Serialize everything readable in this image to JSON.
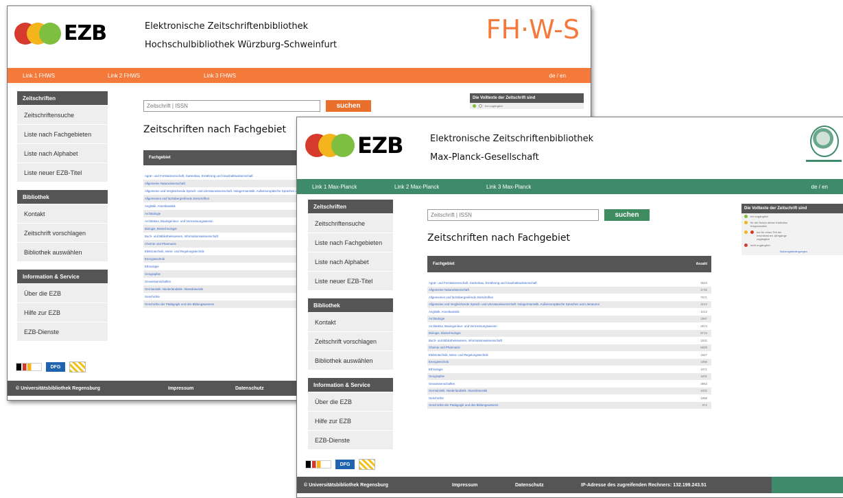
{
  "colors": {
    "fhws_orange": "#f47a3c",
    "mpg_green": "#3e8a6b",
    "button_orange": "#e8702c",
    "button_green": "#3f8c60",
    "dark": "#555555",
    "dot_red": "#d63a2c",
    "dot_yellow": "#f3b41c",
    "dot_green": "#7fbf3f",
    "dot_blue": "#1f78b4"
  },
  "w1": {
    "logo_text": "EZB",
    "title_line1": "Elektronische Zeitschriftenbibliothek",
    "title_line2": "Hochschulbibliothek Würzburg-Schweinfurt",
    "brand": "FH·W-S",
    "nav": [
      "Link 1 FHWS",
      "Link 2 FHWS",
      "Link 3 FHWS"
    ],
    "lang": "de / en",
    "sidebar": [
      {
        "head": "Zeitschriften",
        "items": [
          "Zeitschriftensuche",
          "Liste nach Fachgebieten",
          "Liste nach Alphabet",
          "Liste neuer EZB-Titel"
        ]
      },
      {
        "head": "Bibliothek",
        "items": [
          "Kontakt",
          "Zeitschrift vorschlagen",
          "Bibliothek auswählen"
        ]
      },
      {
        "head": "Information & Service",
        "items": [
          "Über die EZB",
          "Hilfe zur EZB",
          "EZB-Dienste"
        ]
      }
    ],
    "search_placeholder": "Zeitschrift | ISSN",
    "search_button": "suchen",
    "page_title": "Zeitschriften nach Fachgebiet",
    "table_header": "Fachgebiet",
    "rows": [
      "Agrar- und Forstwissenschaft, Gartenbau, Ernährung und Haushaltswissenschaft",
      "Allgemeine Naturwissenschaft",
      "Allgemeine und Vergleichende Sprach- und Literaturwissenschaft. Indogermanistik. Außereuropäische Sprachen und Literaturen",
      "Allgemeines und fachübergreifende Zeitschriften",
      "Anglistik. Amerikanistik",
      "Archäologie",
      "Architektur, Bauingenieur- und Vermessungswesen",
      "Biologie, Biotechnologie",
      "Buch- und Bibliothekswesen, Informationswissenschaft",
      "Chemie und Pharmazie",
      "Elektrotechnik, Mess- und Regelungstechnik",
      "Energietechnik",
      "Ethnologie",
      "Geographie",
      "Geowissenschaften",
      "Germanistik. Niederlandistik. Skandinavistik",
      "Geschichte",
      "Geschichte der Pädagogik und des Bildungswesens"
    ],
    "legend_title": "Die Volltexte der Zeitschrift sind",
    "legend_first": "frei zugänglich",
    "badges": [
      "DFG"
    ],
    "footer": [
      "© Universitätsbibliothek Regensburg",
      "Impressum",
      "Datenschutz"
    ]
  },
  "w2": {
    "logo_text": "EZB",
    "title_line1": "Elektronische Zeitschriftenbibliothek",
    "title_line2": "Max-Planck-Gesellschaft",
    "nav": [
      "Link 1 Max-Planck",
      "Link 2 Max-Planck",
      "Link 3 Max-Planck"
    ],
    "lang": "de / en",
    "sidebar": [
      {
        "head": "Zeitschriften",
        "items": [
          "Zeitschriftensuche",
          "Liste nach Fachgebieten",
          "Liste nach Alphabet",
          "Liste neuer EZB-Titel"
        ]
      },
      {
        "head": "Bibliothek",
        "items": [
          "Kontakt",
          "Zeitschrift vorschlagen",
          "Bibliothek auswählen"
        ]
      },
      {
        "head": "Information & Service",
        "items": [
          "Über die EZB",
          "Hilfe zur EZB",
          "EZB-Dienste"
        ]
      }
    ],
    "search_placeholder": "Zeitschrift | ISSN",
    "search_button": "suchen",
    "page_title": "Zeitschriften nach Fachgebiet",
    "table_header": "Fachgebiet",
    "table_header_count": "Anzahl",
    "rows": [
      {
        "name": "Agrar- und Forstwissenschaft, Gartenbau, Ernährung und Haushaltswissenschaft",
        "count": "4523"
      },
      {
        "name": "Allgemeine Naturwissenschaft",
        "count": "1732"
      },
      {
        "name": "Allgemeines und fachübergreifende Zeitschriften",
        "count": "7671"
      },
      {
        "name": "Allgemeine und Vergleichende Sprach- und Literaturwissenschaft. Indogermanistik. Außereuropäische Sprachen und Literaturen",
        "count": "3212"
      },
      {
        "name": "Anglistik. Amerikanistik",
        "count": "1012"
      },
      {
        "name": "Archäologie",
        "count": "1557"
      },
      {
        "name": "Architektur, Bauingenieur- und Vermessungswesen",
        "count": "2574"
      },
      {
        "name": "Biologie, Biotechnologie",
        "count": "8713"
      },
      {
        "name": "Buch- und Bibliothekswesen, Informationswissenschaft",
        "count": "1532"
      },
      {
        "name": "Chemie und Pharmazie",
        "count": "5929"
      },
      {
        "name": "Elektrotechnik, Mess- und Regelungstechnik",
        "count": "1927"
      },
      {
        "name": "Energietechnik",
        "count": "1056"
      },
      {
        "name": "Ethnologie",
        "count": "1071"
      },
      {
        "name": "Geographie",
        "count": "1631"
      },
      {
        "name": "Geowissenschaften",
        "count": "3963"
      },
      {
        "name": "Germanistik. Niederlandistik. Skandinavistik",
        "count": "1032"
      },
      {
        "name": "Geschichte",
        "count": "1958"
      },
      {
        "name": "Geschichte der Pädagogik und des Bildungswesens",
        "count": "872"
      }
    ],
    "legend_title": "Die Volltexte der Zeitschrift sind",
    "legend": [
      "frei zugänglich",
      "für die Nutzer dieser Institution freigeschaltet",
      "nur für einen Teil der erschienenen Jahrgänge zugänglich",
      "nicht zugänglich"
    ],
    "legend_link": "Nutzungsbedingungen",
    "badges": [
      "DFG"
    ],
    "footer": [
      "© Universitätsbibliothek Regensburg",
      "Impressum",
      "Datenschutz",
      "IP-Adresse des zugreifenden Rechners: 132.199.243.51"
    ]
  }
}
